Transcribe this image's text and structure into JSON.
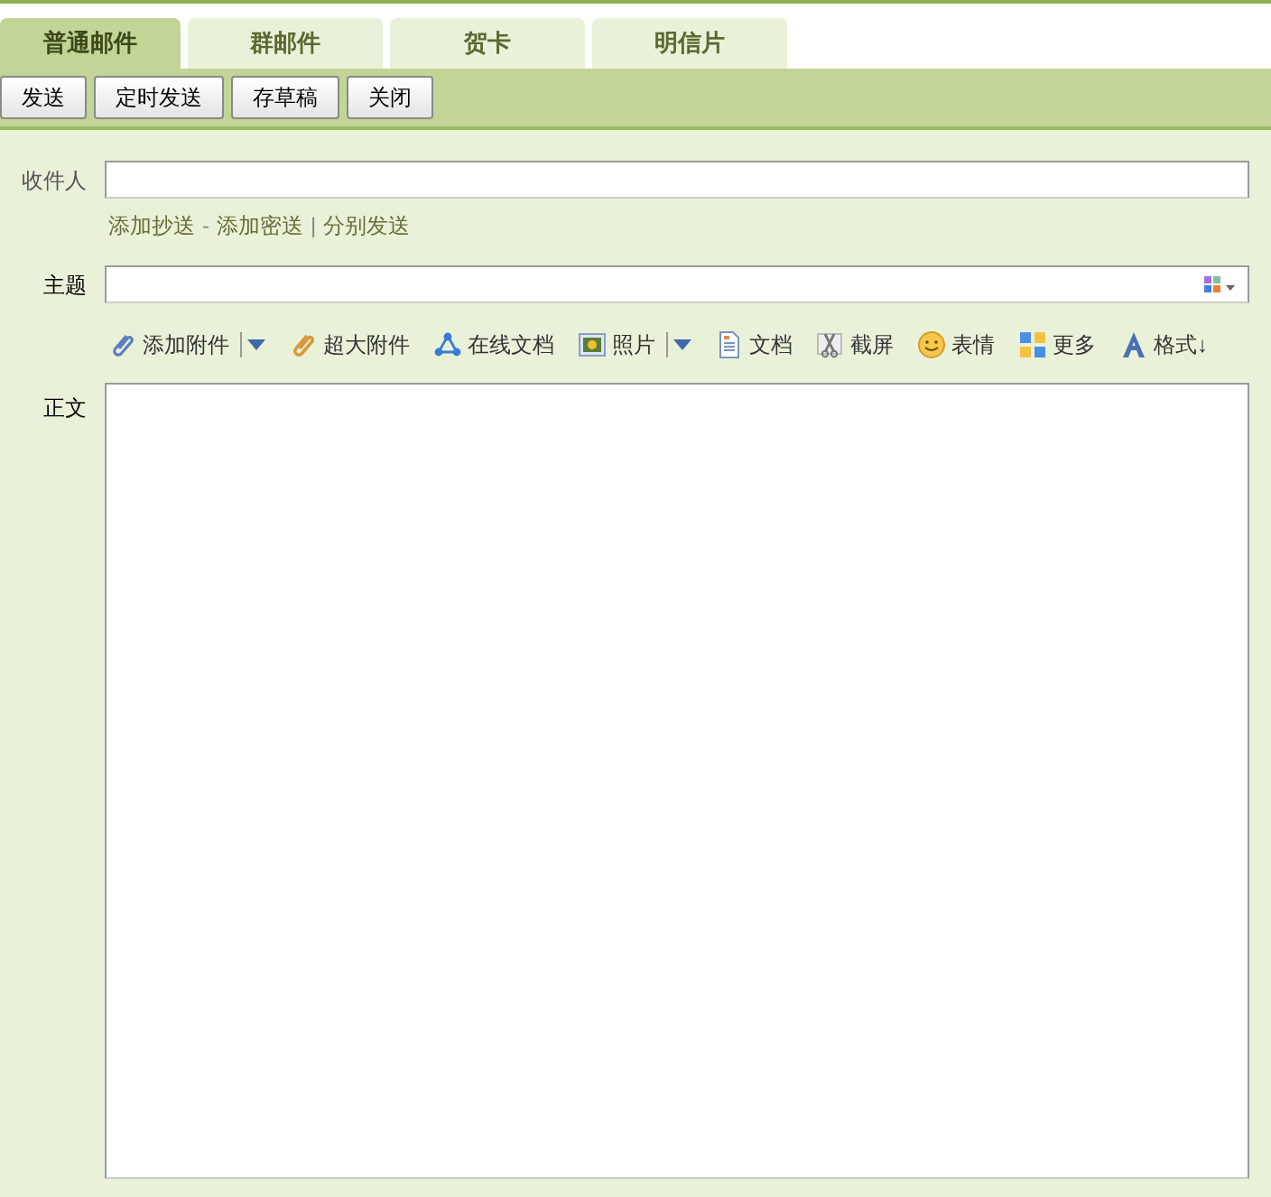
{
  "tabs": [
    {
      "label": "普通邮件",
      "selected": true
    },
    {
      "label": "群邮件",
      "selected": false
    },
    {
      "label": "贺卡",
      "selected": false
    },
    {
      "label": "明信片",
      "selected": false
    }
  ],
  "actions": [
    "发送",
    "定时发送",
    "存草稿",
    "关闭"
  ],
  "recipient": {
    "label": "收件人"
  },
  "recipient_links": [
    {
      "kind": "link",
      "text": "添加抄送"
    },
    {
      "kind": "separator",
      "text": "-"
    },
    {
      "kind": "link",
      "text": "添加密送"
    },
    {
      "kind": "separator",
      "text": "|"
    },
    {
      "kind": "link",
      "text": "分别发送"
    }
  ],
  "subject": {
    "label": "主题"
  },
  "insert_toolbar": [
    {
      "kind": "paperclip",
      "label": "添加附件",
      "dropdown": true
    },
    {
      "kind": "bigclip",
      "label": "超大附件",
      "dropdown": false
    },
    {
      "kind": "share",
      "label": "在线文档",
      "dropdown": false
    },
    {
      "kind": "photo",
      "label": "照片",
      "dropdown": true
    },
    {
      "kind": "document",
      "label": "文档",
      "dropdown": false
    },
    {
      "kind": "scissors",
      "label": "截屏",
      "dropdown": false
    },
    {
      "kind": "smiley",
      "label": "表情",
      "dropdown": false
    },
    {
      "kind": "grid",
      "label": "更多",
      "dropdown": false
    },
    {
      "kind": "font",
      "label": "格式↓",
      "dropdown": false
    }
  ],
  "body": {
    "label": "正文"
  }
}
